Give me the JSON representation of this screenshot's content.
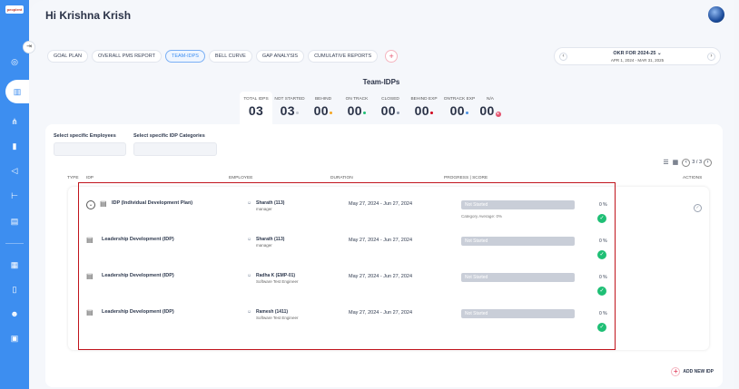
{
  "brand": {
    "logo_text": "peoplent"
  },
  "header": {
    "greeting": "Hi Krishna Krish"
  },
  "tabs": [
    {
      "label": "GOAL PLAN"
    },
    {
      "label": "OVERALL PMS REPORT"
    },
    {
      "label": "TEAM-IDPS"
    },
    {
      "label": "BELL CURVE"
    },
    {
      "label": "GAP ANALYSIS"
    },
    {
      "label": "CUMULATIVE REPORTS"
    }
  ],
  "okr": {
    "title": "OKR FOR 2024-25 ⌄",
    "range": "APR 1, 2024 - MAR 31, 2025"
  },
  "section_title": "Team-IDPs",
  "stats": [
    {
      "label": "TOTAL IDPS",
      "value": "03",
      "dot": "",
      "color": ""
    },
    {
      "label": "NOT STARTED",
      "value": "03",
      "dot": "y",
      "color": "#c4c9d2"
    },
    {
      "label": "BEHIND",
      "value": "00",
      "dot": "y",
      "color": "#f5a623"
    },
    {
      "label": "ON TRACK",
      "value": "00",
      "dot": "y",
      "color": "#1fbf75"
    },
    {
      "label": "CLOSED",
      "value": "00",
      "dot": "y",
      "color": "#8a94a6"
    },
    {
      "label": "BEHIND EXP",
      "value": "00",
      "dot": "y",
      "color": "#d0021b"
    },
    {
      "label": "ONTRACK EXP",
      "value": "00",
      "dot": "y",
      "color": "#4a90e2"
    },
    {
      "label": "N/A",
      "value": "00",
      "dot": "x",
      "color": "#e4516d"
    }
  ],
  "filters": {
    "employees_label": "Select specific Employees",
    "categories_label": "Select specific IDP Categories"
  },
  "pagination": {
    "text": "3 / 3"
  },
  "table": {
    "headers": {
      "type": "TYPE",
      "idp": "IDP",
      "employee": "EMPLOYEE",
      "duration": "DURATION",
      "progress": "PROGRESS | SCORE",
      "actions": "ACTIONS"
    },
    "rows": [
      {
        "name": "IDP (Individual Development Plan)",
        "employee": "Sharath (113)",
        "role": "manager",
        "duration": "May 27, 2024 - Jun 27, 2024",
        "status": "Not Started",
        "percent": "0 %",
        "avg": "Category Average: 0%"
      },
      {
        "name": "Leadership Development (IDP)",
        "employee": "Sharath (113)",
        "role": "manager",
        "duration": "May 27, 2024 - Jun 27, 2024",
        "status": "Not Started",
        "percent": "0 %"
      },
      {
        "name": "Leadership Development (IDP)",
        "employee": "Radha K (EMP-01)",
        "role": "Software Test Engineer",
        "duration": "May 27, 2024 - Jun 27, 2024",
        "status": "Not Started",
        "percent": "0 %"
      },
      {
        "name": "Leadership Development (IDP)",
        "employee": "Ramesh (1411)",
        "role": "Software Test Engineer",
        "duration": "May 27, 2024 - Jun 27, 2024",
        "status": "Not Started",
        "percent": "0 %"
      }
    ]
  },
  "add_idp_label": "ADD NEW IDP"
}
